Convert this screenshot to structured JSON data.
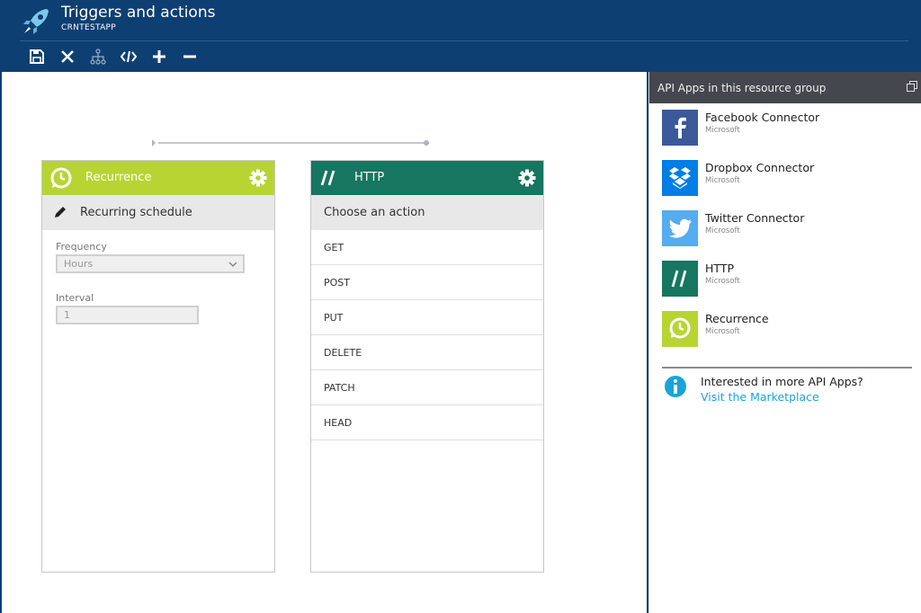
{
  "header": {
    "title": "Triggers and actions",
    "subtitle": "CRNTESTAPP",
    "toolbar": [
      "save-icon",
      "discard-icon",
      "hierarchy-icon",
      "code-view-icon",
      "zoom-in-icon",
      "zoom-out-icon"
    ]
  },
  "cards": {
    "recurrence": {
      "title": "Recurrence",
      "header_color": "#b8d432",
      "subheader": "Recurring schedule",
      "frequency_label": "Frequency",
      "frequency_value": "Hours",
      "interval_label": "Interval",
      "interval_value": "1"
    },
    "http": {
      "title": "HTTP",
      "header_color": "#167660",
      "subheader": "Choose an action",
      "actions": [
        "GET",
        "POST",
        "PUT",
        "DELETE",
        "PATCH",
        "HEAD"
      ]
    }
  },
  "panel": {
    "title": "API Apps in this resource group",
    "apps": [
      {
        "name": "Facebook Connector",
        "publisher": "Microsoft",
        "color": "#3b5998"
      },
      {
        "name": "Dropbox Connector",
        "publisher": "Microsoft",
        "color": "#007ee5"
      },
      {
        "name": "Twitter Connector",
        "publisher": "Microsoft",
        "color": "#55acee"
      },
      {
        "name": "HTTP",
        "publisher": "Microsoft",
        "color": "#167660"
      },
      {
        "name": "Recurrence",
        "publisher": "Microsoft",
        "color": "#b8d432"
      }
    ],
    "info_text": "Interested in more API Apps?",
    "info_link": "Visit the Marketplace"
  },
  "colors": {
    "header_bg": "#0e3f73",
    "panel_head_bg": "#45474f",
    "link": "#1aa3d9"
  }
}
